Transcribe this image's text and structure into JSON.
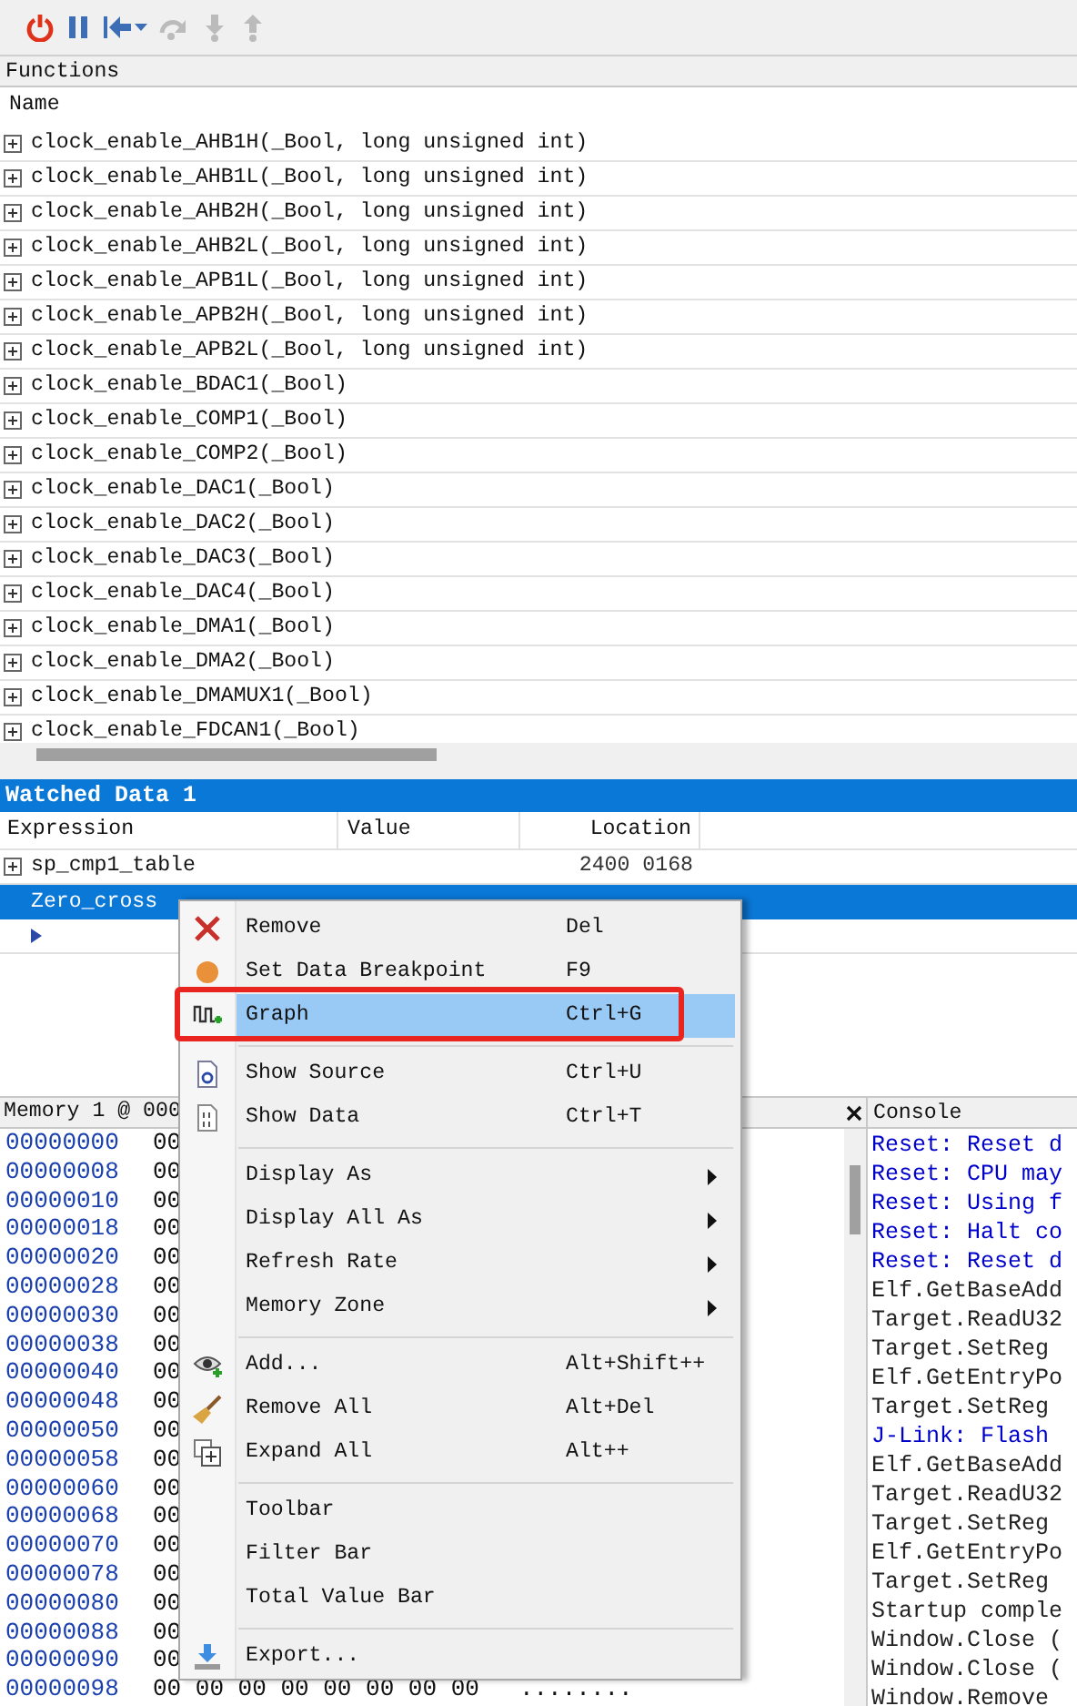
{
  "toolbar": [
    {
      "kind": "power",
      "disabled": false
    },
    {
      "kind": "pause",
      "disabled": false
    },
    {
      "kind": "reset",
      "disabled": false
    },
    {
      "kind": "step-over",
      "disabled": true
    },
    {
      "kind": "step-into",
      "disabled": true
    },
    {
      "kind": "step-out",
      "disabled": true
    }
  ],
  "functions": {
    "title": "Functions",
    "column": "Name",
    "rows": [
      "clock_enable_AHB1H(_Bool, long unsigned int)",
      "clock_enable_AHB1L(_Bool, long unsigned int)",
      "clock_enable_AHB2H(_Bool, long unsigned int)",
      "clock_enable_AHB2L(_Bool, long unsigned int)",
      "clock_enable_APB1L(_Bool, long unsigned int)",
      "clock_enable_APB2H(_Bool, long unsigned int)",
      "clock_enable_APB2L(_Bool, long unsigned int)",
      "clock_enable_BDAC1(_Bool)",
      "clock_enable_COMP1(_Bool)",
      "clock_enable_COMP2(_Bool)",
      "clock_enable_DAC1(_Bool)",
      "clock_enable_DAC2(_Bool)",
      "clock_enable_DAC3(_Bool)",
      "clock_enable_DAC4(_Bool)",
      "clock_enable_DMA1(_Bool)",
      "clock_enable_DMA2(_Bool)",
      "clock_enable_DMAMUX1(_Bool)",
      "clock_enable_FDCAN1(_Bool)"
    ]
  },
  "watch": {
    "title": "Watched Data 1",
    "columns": [
      "Expression",
      "Value",
      "Location"
    ],
    "rows": [
      {
        "kind": "expandable",
        "expression": "sp_cmp1_table",
        "location": "2400 0168",
        "selected": false
      },
      {
        "kind": "plain",
        "expression": "Zero_cross",
        "selected": true
      },
      {
        "kind": "new",
        "selected": false
      }
    ]
  },
  "memory": {
    "title": "Memory 1 @ 000",
    "rows": [
      {
        "address": "00000000",
        "bytes": "00"
      },
      {
        "address": "00000008",
        "bytes": "00"
      },
      {
        "address": "00000010",
        "bytes": "00"
      },
      {
        "address": "00000018",
        "bytes": "00"
      },
      {
        "address": "00000020",
        "bytes": "00"
      },
      {
        "address": "00000028",
        "bytes": "00"
      },
      {
        "address": "00000030",
        "bytes": "00"
      },
      {
        "address": "00000038",
        "bytes": "00"
      },
      {
        "address": "00000040",
        "bytes": "00"
      },
      {
        "address": "00000048",
        "bytes": "00"
      },
      {
        "address": "00000050",
        "bytes": "00"
      },
      {
        "address": "00000058",
        "bytes": "00"
      },
      {
        "address": "00000060",
        "bytes": "00"
      },
      {
        "address": "00000068",
        "bytes": "00"
      },
      {
        "address": "00000070",
        "bytes": "00"
      },
      {
        "address": "00000078",
        "bytes": "00"
      },
      {
        "address": "00000080",
        "bytes": "00"
      },
      {
        "address": "00000088",
        "bytes": "00"
      },
      {
        "address": "00000090",
        "bytes": "00"
      },
      {
        "address": "00000098",
        "bytes": "00 00 00 00 00 00 00 00",
        "ascii": "........"
      }
    ]
  },
  "console": {
    "title": "Console",
    "lines": [
      {
        "text": "Reset: Reset d",
        "color": "#0000cc"
      },
      {
        "text": "Reset: CPU may",
        "color": "#0000cc"
      },
      {
        "text": "Reset: Using f",
        "color": "#0000cc"
      },
      {
        "text": "Reset: Halt co",
        "color": "#0000cc"
      },
      {
        "text": "Reset: Reset d",
        "color": "#0000cc"
      },
      {
        "text": "Elf.GetBaseAdd",
        "color": "#222222"
      },
      {
        "text": "Target.ReadU32",
        "color": "#222222"
      },
      {
        "text": "Target.SetReg",
        "color": "#222222"
      },
      {
        "text": "Elf.GetEntryPo",
        "color": "#222222"
      },
      {
        "text": "Target.SetReg",
        "color": "#222222"
      },
      {
        "text": "J-Link: Flash",
        "color": "#0000cc"
      },
      {
        "text": "Elf.GetBaseAdd",
        "color": "#222222"
      },
      {
        "text": "Target.ReadU32",
        "color": "#222222"
      },
      {
        "text": "Target.SetReg",
        "color": "#222222"
      },
      {
        "text": "Elf.GetEntryPo",
        "color": "#222222"
      },
      {
        "text": "Target.SetReg",
        "color": "#222222"
      },
      {
        "text": "Startup comple",
        "color": "#222222"
      },
      {
        "text": "Window.Close (",
        "color": "#222222"
      },
      {
        "text": "Window.Close (",
        "color": "#222222"
      },
      {
        "text": "Window.Remove",
        "color": "#222222"
      }
    ]
  },
  "context_menu": [
    {
      "kind": "item",
      "label": "Remove",
      "shortcut": "Del",
      "selected": false
    },
    {
      "kind": "item",
      "label": "Set Data Breakpoint",
      "shortcut": "F9",
      "selected": false
    },
    {
      "kind": "item",
      "label": "Graph",
      "shortcut": "Ctrl+G",
      "selected": true,
      "outlined": true
    },
    {
      "kind": "separator"
    },
    {
      "kind": "item",
      "label": "Show Source",
      "shortcut": "Ctrl+U",
      "selected": false
    },
    {
      "kind": "item",
      "label": "Show Data",
      "shortcut": "Ctrl+T",
      "selected": false
    },
    {
      "kind": "separator"
    },
    {
      "kind": "submenu",
      "label": "Display As",
      "selected": false
    },
    {
      "kind": "submenu",
      "label": "Display All As",
      "selected": false
    },
    {
      "kind": "submenu",
      "label": "Refresh Rate",
      "selected": false
    },
    {
      "kind": "submenu",
      "label": "Memory Zone",
      "selected": false
    },
    {
      "kind": "separator"
    },
    {
      "kind": "item",
      "label": "Add...",
      "shortcut": "Alt+Shift++",
      "selected": false
    },
    {
      "kind": "item",
      "label": "Remove All",
      "shortcut": "Alt+Del",
      "selected": false
    },
    {
      "kind": "item",
      "label": "Expand All",
      "shortcut": "Alt++",
      "selected": false
    },
    {
      "kind": "separator"
    },
    {
      "kind": "item",
      "label": "Toolbar",
      "selected": false
    },
    {
      "kind": "item",
      "label": "Filter Bar",
      "selected": false
    },
    {
      "kind": "item",
      "label": "Total Value Bar",
      "selected": false
    },
    {
      "kind": "separator"
    },
    {
      "kind": "item",
      "label": "Export...",
      "selected": false
    }
  ]
}
